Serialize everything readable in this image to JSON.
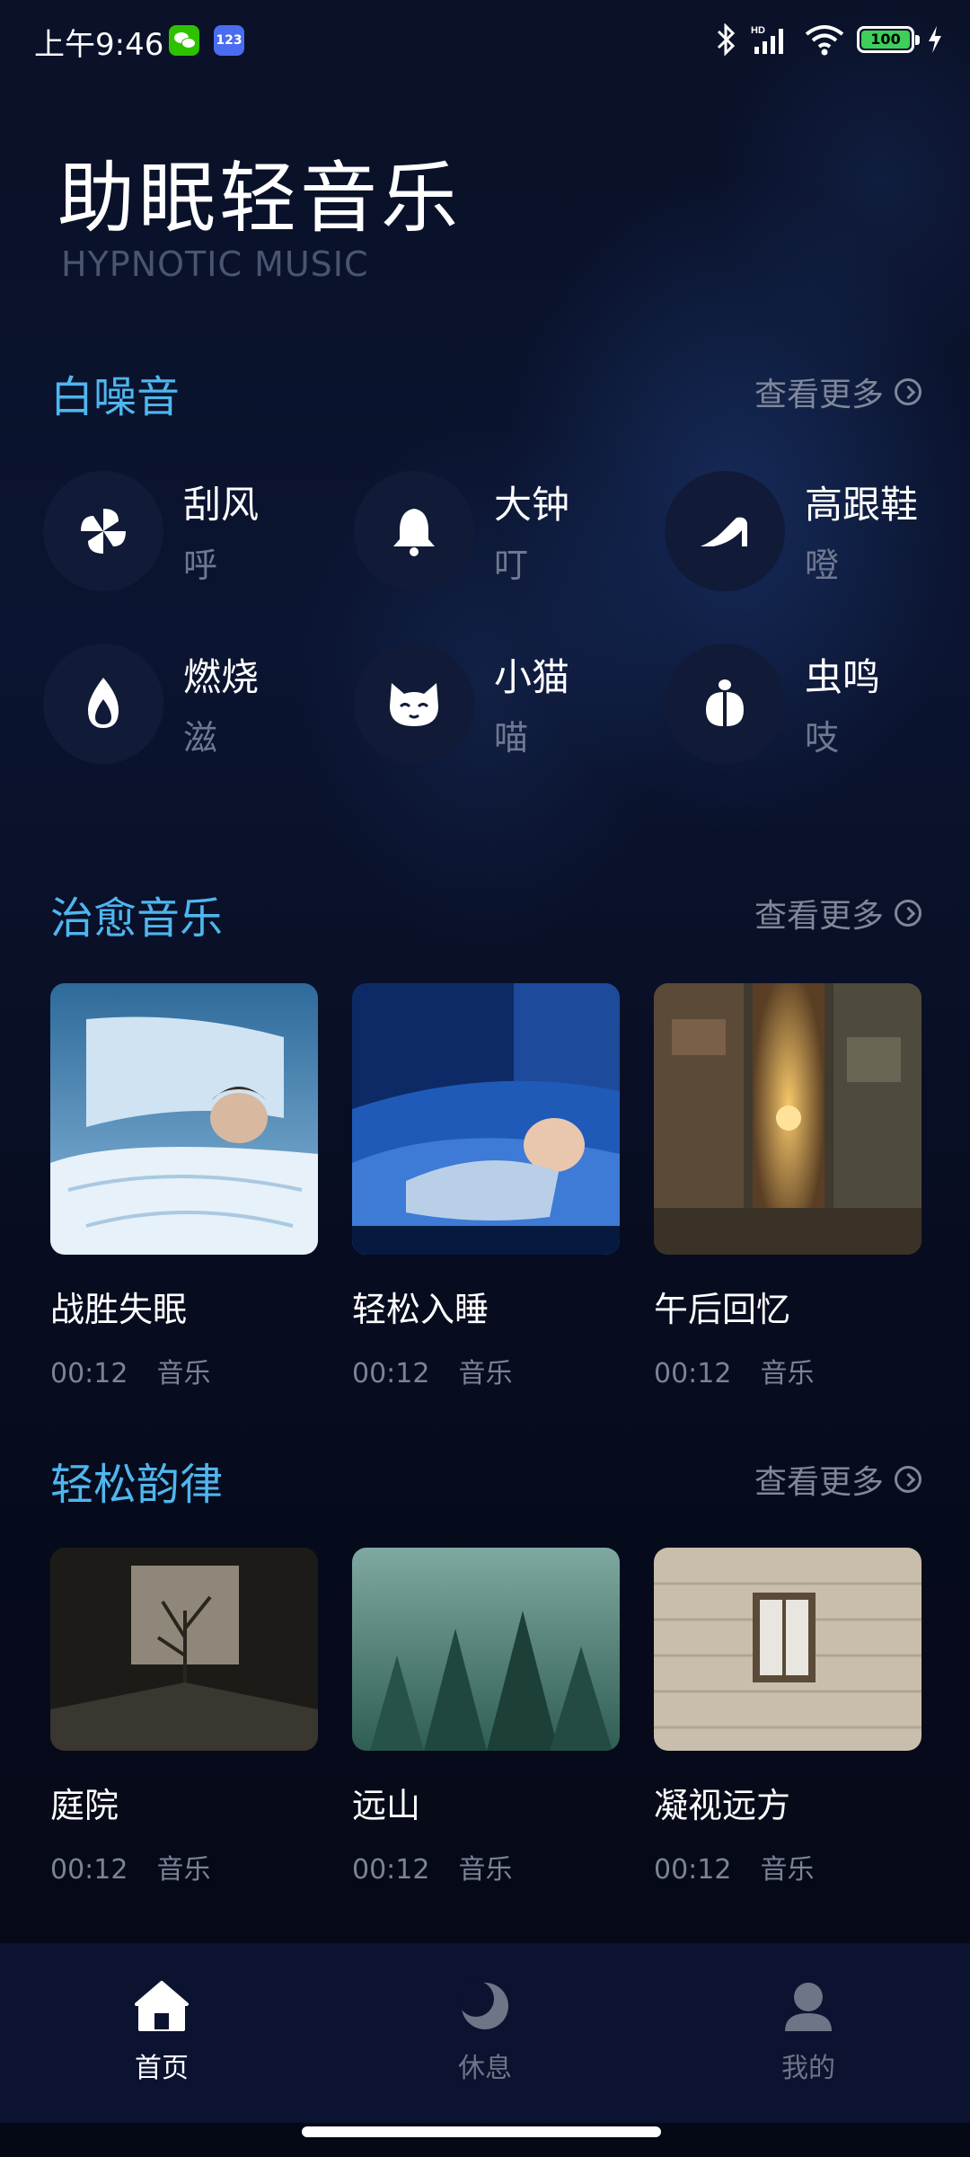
{
  "status_bar": {
    "time": "上午9:46",
    "notification_badge": "123",
    "battery": "100"
  },
  "header": {
    "title": "助眠轻音乐",
    "subtitle": "HYPNOTIC MUSIC"
  },
  "white_noise": {
    "title": "白噪音",
    "see_more": "查看更多",
    "items": [
      {
        "name": "刮风",
        "sound": "呼",
        "icon": "pinwheel-icon"
      },
      {
        "name": "大钟",
        "sound": "叮",
        "icon": "bell-icon"
      },
      {
        "name": "高跟鞋",
        "sound": "噔",
        "icon": "high-heel-icon"
      },
      {
        "name": "燃烧",
        "sound": "滋",
        "icon": "flame-icon"
      },
      {
        "name": "小猫",
        "sound": "喵",
        "icon": "cat-icon"
      },
      {
        "name": "虫鸣",
        "sound": "吱",
        "icon": "beetle-icon"
      }
    ]
  },
  "healing_music": {
    "title": "治愈音乐",
    "see_more": "查看更多",
    "items": [
      {
        "title": "战胜失眠",
        "duration": "00:12",
        "type": "音乐"
      },
      {
        "title": "轻松入睡",
        "duration": "00:12",
        "type": "音乐"
      },
      {
        "title": "午后回忆",
        "duration": "00:12",
        "type": "音乐"
      }
    ]
  },
  "relaxing_rhythm": {
    "title": "轻松韵律",
    "see_more": "查看更多",
    "items": [
      {
        "title": "庭院",
        "duration": "00:12",
        "type": "音乐"
      },
      {
        "title": "远山",
        "duration": "00:12",
        "type": "音乐"
      },
      {
        "title": "凝视远方",
        "duration": "00:12",
        "type": "音乐"
      }
    ]
  },
  "bottom_nav": {
    "items": [
      {
        "label": "首页",
        "icon": "home-icon",
        "active": true
      },
      {
        "label": "休息",
        "icon": "moon-icon",
        "active": false
      },
      {
        "label": "我的",
        "icon": "profile-icon",
        "active": false
      }
    ]
  },
  "colors": {
    "accent": "#4fb6ee",
    "background": "#060a1a",
    "nav_background": "#0b1330",
    "icon_circle": "#111a37"
  }
}
